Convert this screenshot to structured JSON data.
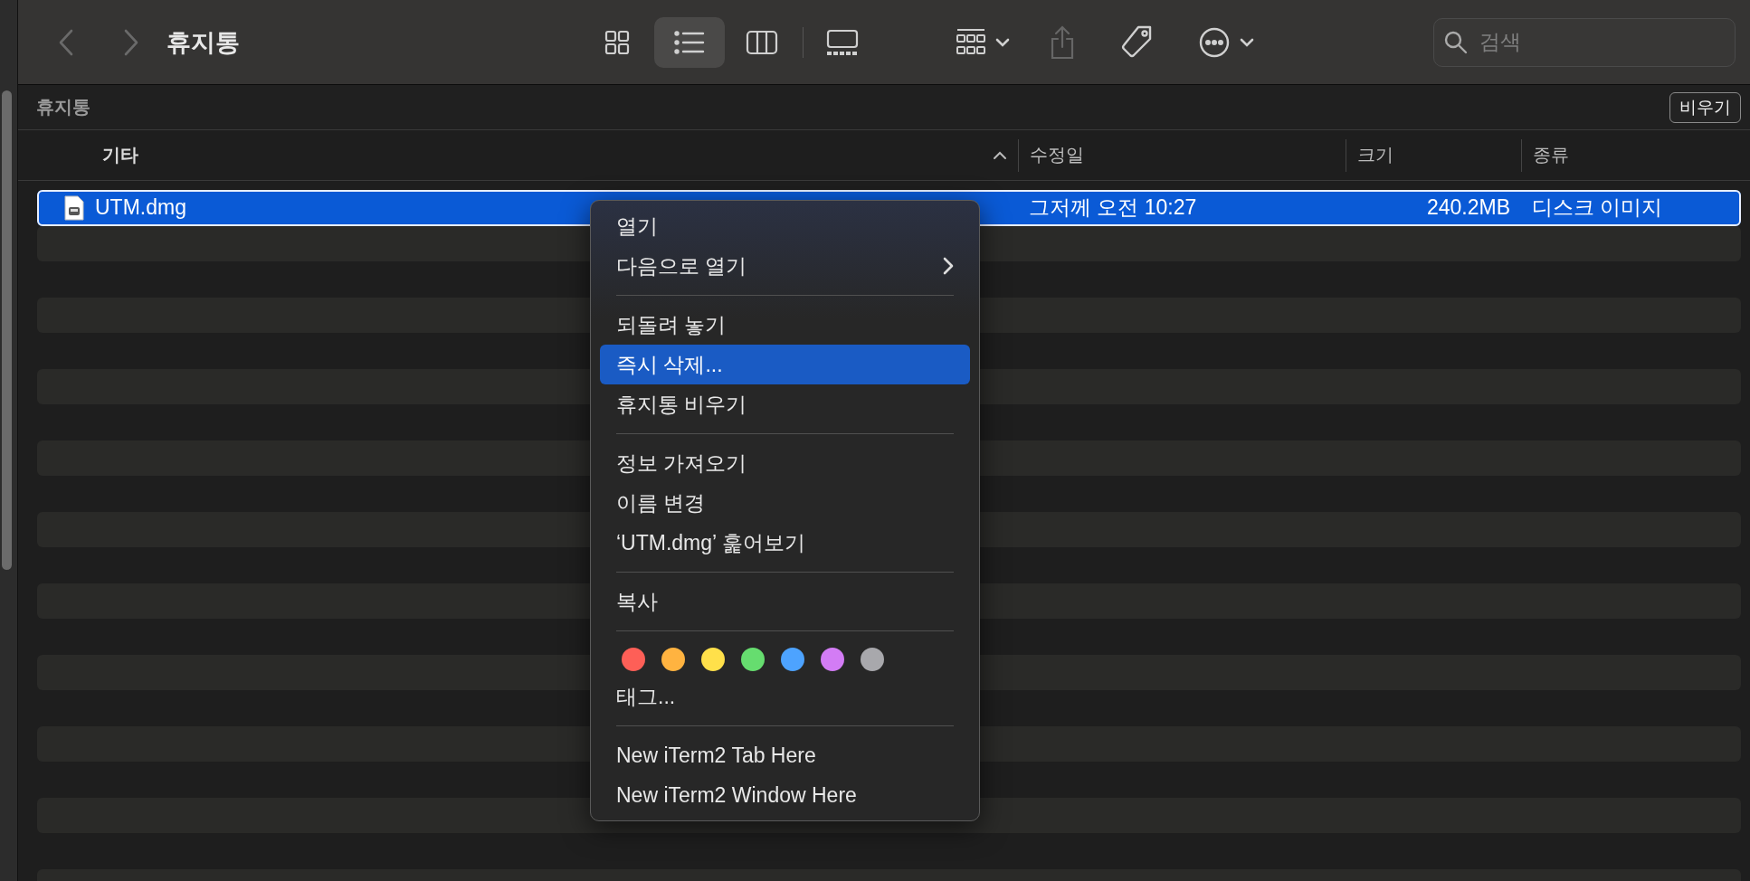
{
  "toolbar": {
    "title": "휴지통",
    "back_disabled": true,
    "forward_disabled": true,
    "views": [
      {
        "kind": "icons",
        "selected": false
      },
      {
        "kind": "list",
        "selected": true
      },
      {
        "kind": "columns",
        "selected": false
      },
      {
        "kind": "gallery",
        "selected": false
      }
    ],
    "share_disabled": true,
    "search": {
      "placeholder": "검색"
    }
  },
  "path_bar": {
    "title": "휴지통",
    "button": "비우기"
  },
  "columns": [
    {
      "label": "기타",
      "sorted": true
    },
    {
      "label": "수정일",
      "sorted": false
    },
    {
      "label": "크기",
      "sorted": false
    },
    {
      "label": "종류",
      "sorted": false
    }
  ],
  "rows": [
    {
      "name": "UTM.dmg",
      "modified": "그저께 오전 10:27",
      "size": "240.2MB",
      "kind": "디스크 이미지",
      "selected": true
    }
  ],
  "context_menu": {
    "groups": [
      {
        "kind": "items",
        "items": [
          {
            "label": "열기",
            "selected": false,
            "submenu": false
          },
          {
            "label": "다음으로 열기",
            "selected": false,
            "submenu": true
          }
        ]
      },
      {
        "kind": "items",
        "items": [
          {
            "label": "되돌려 놓기",
            "selected": false,
            "submenu": false
          },
          {
            "label": "즉시 삭제...",
            "selected": true,
            "submenu": false
          },
          {
            "label": "휴지통 비우기",
            "selected": false,
            "submenu": false
          }
        ]
      },
      {
        "kind": "items",
        "items": [
          {
            "label": "정보 가져오기",
            "selected": false,
            "submenu": false
          },
          {
            "label": "이름 변경",
            "selected": false,
            "submenu": false
          },
          {
            "label": "‘UTM.dmg’ 훑어보기",
            "selected": false,
            "submenu": false
          }
        ]
      },
      {
        "kind": "items",
        "items": [
          {
            "label": "복사",
            "selected": false,
            "submenu": false
          }
        ]
      },
      {
        "kind": "tags",
        "colors": [
          {
            "color": "#fe5f57"
          },
          {
            "color": "#ffb340"
          },
          {
            "color": "#ffe04a"
          },
          {
            "color": "#66dd6f"
          },
          {
            "color": "#4da3ff"
          },
          {
            "color": "#d37cf5"
          },
          {
            "color": "#a8a8ac"
          }
        ],
        "label": "태그..."
      },
      {
        "kind": "items",
        "items": [
          {
            "label": "New iTerm2 Tab Here",
            "selected": false,
            "submenu": false
          },
          {
            "label": "New iTerm2 Window Here",
            "selected": false,
            "submenu": false
          }
        ]
      }
    ]
  }
}
